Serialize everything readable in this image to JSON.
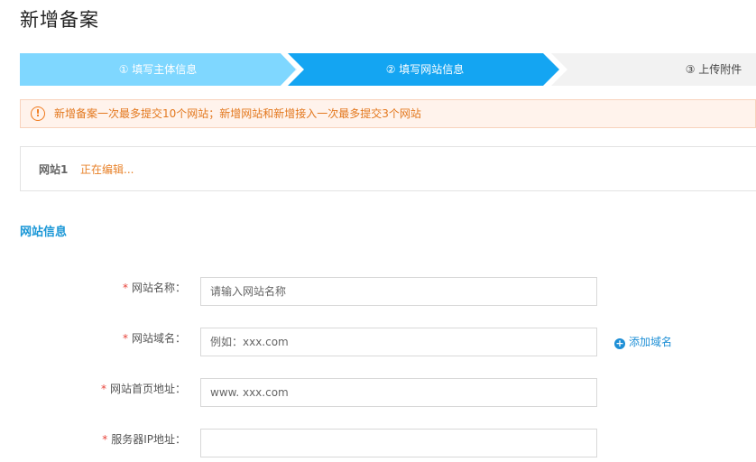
{
  "page": {
    "title": "新增备案"
  },
  "steps": [
    {
      "label": "① 填写主体信息",
      "state": "done"
    },
    {
      "label": "② 填写网站信息",
      "state": "active"
    },
    {
      "label": "③ 上传附件",
      "state": "pending"
    }
  ],
  "alert": {
    "icon": "exclamation-circle-icon",
    "text": "新增备案一次最多提交10个网站；新增网站和新增接入一次最多提交3个网站"
  },
  "site": {
    "name": "网站1",
    "status": "正在编辑..."
  },
  "section": {
    "title": "网站信息"
  },
  "form": {
    "required_mark": "*",
    "site_name": {
      "label": "网站名称：",
      "placeholder": "请输入网站名称",
      "value": ""
    },
    "domain": {
      "label": "网站域名：",
      "placeholder": "例如：xxx.com",
      "value": "",
      "add_label": "添加域名",
      "add_icon": "plus-circle-icon"
    },
    "homepage": {
      "label": "网站首页地址：",
      "placeholder": "www. xxx.com",
      "value": ""
    },
    "server_ip": {
      "label": "服务器IP地址：",
      "placeholder": "",
      "value": ""
    }
  },
  "colors": {
    "step_done": "#7fd7ff",
    "step_active": "#14a5f2",
    "step_pending": "#f2f2f2",
    "alert_text": "#e3781e",
    "accent": "#1896d6",
    "required": "#e8433a"
  }
}
